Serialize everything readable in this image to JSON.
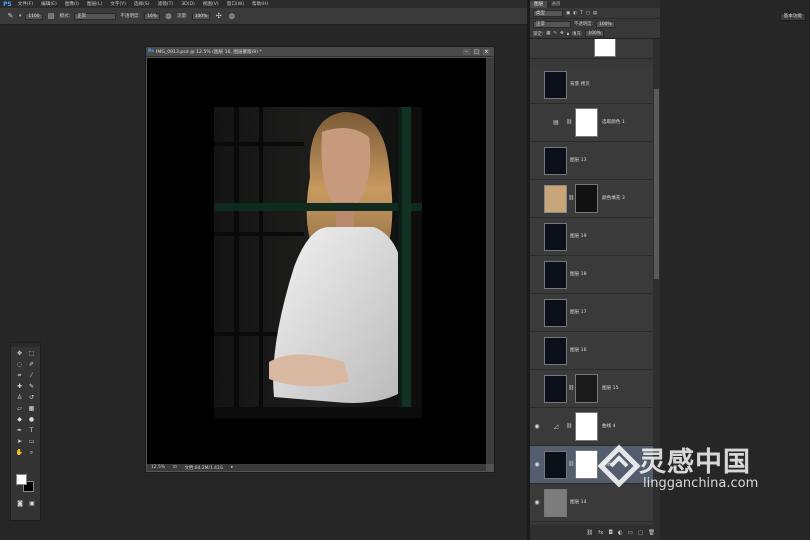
{
  "app": {
    "logo": "PS"
  },
  "menu": [
    "文件(F)",
    "编辑(E)",
    "图像(I)",
    "图层(L)",
    "文字(Y)",
    "选择(S)",
    "滤镜(T)",
    "3D(D)",
    "视图(V)",
    "窗口(W)",
    "帮助(H)"
  ],
  "options": {
    "brush_size": "1100",
    "mode_label": "模式:",
    "mode_value": "正常",
    "opacity_label": "不透明度:",
    "opacity_value": "16%",
    "flow_label": "流量:",
    "flow_value": "100%"
  },
  "document": {
    "title": "IMG_0913.psd @ 12.5% (图层 16, 图层蒙版/8) *",
    "zoom": "12.5%",
    "doc_info": "文档:84.2M/1.41G"
  },
  "layers_panel": {
    "tabs": [
      "图层",
      "通道"
    ],
    "filter_label": "类型",
    "blend_mode": "正常",
    "opacity_label": "不透明度:",
    "opacity_value": "100%",
    "lock_label": "锁定:",
    "fill_label": "填充:",
    "fill_value": "100%",
    "layers": [
      {
        "name": "背景 拷贝",
        "kind": "photo",
        "visible": false
      },
      {
        "name": "选取颜色 1",
        "kind": "adjustment",
        "visible": false
      },
      {
        "name": "图层 13",
        "kind": "photo",
        "visible": false
      },
      {
        "name": "颜色填充 3",
        "kind": "fill",
        "visible": false
      },
      {
        "name": "图层 19",
        "kind": "photo",
        "visible": false
      },
      {
        "name": "图层 18",
        "kind": "photo",
        "visible": false
      },
      {
        "name": "图层 17",
        "kind": "photo",
        "visible": false
      },
      {
        "name": "图层 16",
        "kind": "photo",
        "visible": false
      },
      {
        "name": "图层 15",
        "kind": "photo-mask",
        "visible": false
      },
      {
        "name": "曲线 4",
        "kind": "adjustment",
        "visible": true
      },
      {
        "name": "图层 2",
        "kind": "photo-mask",
        "visible": true,
        "selected": true
      },
      {
        "name": "图层 14",
        "kind": "gray",
        "visible": true
      }
    ]
  },
  "workspace": {
    "essentials": "基本功能"
  },
  "watermark": {
    "cn": "灵感中国",
    "en": "lingganchina.com"
  },
  "colors": {
    "accent": "#4aa3ff",
    "selected_layer": "#545d6e",
    "fill_swatch": "#c9a57a"
  }
}
